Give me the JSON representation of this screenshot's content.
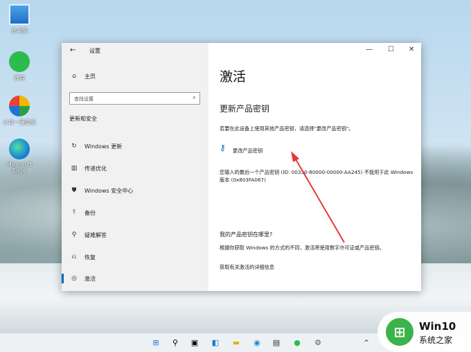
{
  "desktop": {
    "icons": [
      {
        "label": "此电脑",
        "icon": "computer-icon"
      },
      {
        "label": "微信",
        "icon": "wechat-icon"
      },
      {
        "label": "小白一键重装",
        "icon": "installer-icon"
      },
      {
        "label": "Microsoft Edge",
        "icon": "edge-icon"
      }
    ]
  },
  "window": {
    "title": "设置",
    "controls": {
      "minimize": "—",
      "maximize": "☐",
      "close": "✕"
    },
    "sidebar": {
      "home": "主页",
      "search_placeholder": "查找设置",
      "section": "更新和安全",
      "items": [
        {
          "label": "Windows 更新",
          "icon": "refresh-icon"
        },
        {
          "label": "传递优化",
          "icon": "delivery-icon"
        },
        {
          "label": "Windows 安全中心",
          "icon": "shield-icon"
        },
        {
          "label": "备份",
          "icon": "backup-icon"
        },
        {
          "label": "疑难解答",
          "icon": "wrench-icon"
        },
        {
          "label": "恢复",
          "icon": "recovery-icon"
        },
        {
          "label": "激活",
          "icon": "activation-icon"
        }
      ]
    },
    "content": {
      "title": "激活",
      "subtitle": "更新产品密钥",
      "desc": "若要在此设备上使用其他产品密钥，请选择\"更改产品密钥\"。",
      "change_key_link": "更改产品密钥",
      "error_text": "您输入的最后一个产品密钥 (ID: 00330-80000-00000-AA245) 不能用于此 Windows 版本 (0x803FA067)",
      "faq_title": "我的产品密钥在哪里?",
      "faq_text": "根据你获取 Windows 的方式的不同，激活将使用数字许可证或产品密钥。",
      "more_link": "获取有关激活的详细信息"
    }
  },
  "taskbar": {
    "icons": [
      "windows-start-icon",
      "search-icon",
      "task-view-icon",
      "widgets-icon",
      "file-explorer-icon",
      "edge-icon",
      "store-icon",
      "wechat-icon",
      "settings-icon"
    ],
    "tray": "^"
  },
  "watermark": {
    "line1": "Win10",
    "line2": "系统之家"
  },
  "colors": {
    "accent": "#0067c0",
    "arrow": "#e53935"
  }
}
